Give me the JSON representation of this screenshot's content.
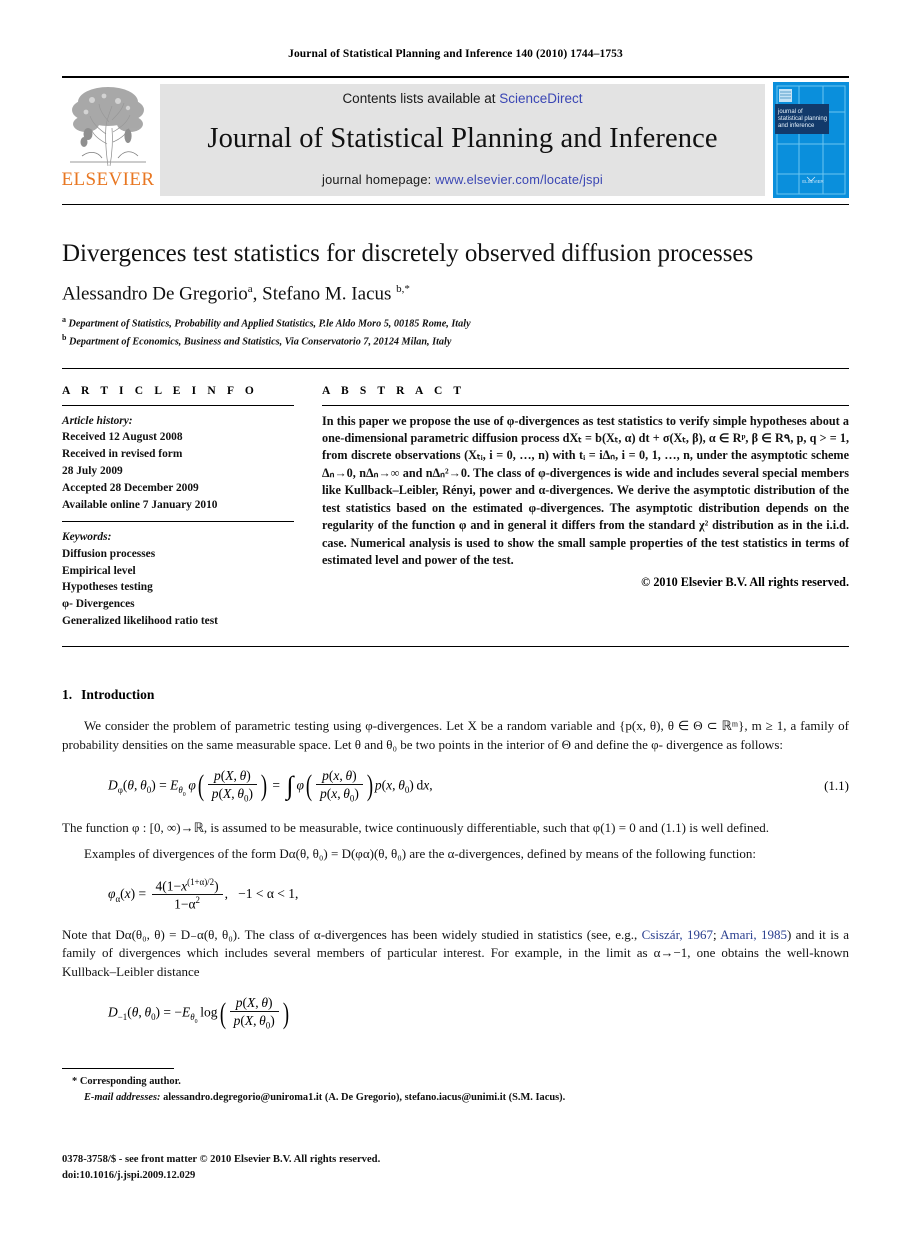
{
  "running_head": "Journal of Statistical Planning and Inference 140 (2010) 1744–1753",
  "masthead": {
    "publisher_wordmark": "ELSEVIER",
    "contents_prefix": "Contents lists available at ",
    "contents_link": "ScienceDirect",
    "journal_title": "Journal of Statistical Planning and Inference",
    "homepage_prefix": "journal homepage: ",
    "homepage_link": "www.elsevier.com/locate/jspi",
    "cover_title_lines": [
      "journal of",
      "statistical planning",
      "and inference"
    ],
    "cover_footer": "ELSEVIER",
    "colors": {
      "link": "#3a46b4",
      "elsevier_orange": "#E87722",
      "band_gray": "#e3e3e3",
      "cover_blue": "#0a8fdc",
      "cover_navy": "#123a6b"
    }
  },
  "article": {
    "title": "Divergences test statistics for discretely observed diffusion processes",
    "authors": "Alessandro De Gregorio ᵃ, Stefano M. Iacus ᵇ,*",
    "author_list": [
      {
        "name": "Alessandro De Gregorio",
        "marker": "a"
      },
      {
        "name": "Stefano M. Iacus",
        "marker": "b,*"
      }
    ],
    "affiliations": [
      {
        "marker": "a",
        "text": "Department of Statistics, Probability and Applied Statistics, P.le Aldo Moro 5, 00185 Rome, Italy"
      },
      {
        "marker": "b",
        "text": "Department of Economics, Business and Statistics, Via Conservatorio 7, 20124 Milan, Italy"
      }
    ]
  },
  "info": {
    "heading": "A R T I C L E   I N F O",
    "history_label": "Article history:",
    "history_lines": [
      "Received 12 August 2008",
      "Received in revised form",
      "28 July 2009",
      "Accepted 28 December 2009",
      "Available online 7 January 2010"
    ],
    "keywords_label": "Keywords:",
    "keywords": [
      "Diffusion processes",
      "Empirical level",
      "Hypotheses testing",
      "φ- Divergences",
      "Generalized likelihood ratio test"
    ]
  },
  "abstract": {
    "heading": "A B S T R A C T",
    "text": "In this paper we propose the use of φ-divergences as test statistics to verify simple hypotheses about a one-dimensional parametric diffusion process dXₜ = b(Xₜ, α) dt + σ(Xₜ, β), α ∈ Rᵖ, β ∈ R۹, p, q > = 1, from discrete observations (Xₜᵢ, i = 0, …, n) with tᵢ = iΔₙ, i = 0, 1, …, n, under the asymptotic scheme Δₙ→0, nΔₙ→∞ and nΔₙ²→0. The class of φ-divergences is wide and includes several special members like Kullback–Leibler, Rényi, power and α-divergences. We derive the asymptotic distribution of the test statistics based on the estimated φ-divergences. The asymptotic distribution depends on the regularity of the function φ and in general it differs from the standard χ² distribution as in the i.i.d. case. Numerical analysis is used to show the small sample properties of the test statistics in terms of estimated level and power of the test.",
    "copyright": "© 2010 Elsevier B.V. All rights reserved."
  },
  "section": {
    "number": "1.",
    "heading": "Introduction",
    "para1": "We consider the problem of parametric testing using φ-divergences. Let X be a random variable and {p(x, θ), θ ∈ Θ ⊂ ℝᵐ}, m ≥ 1, a family of probability densities on the same measurable space. Let θ and θ₀ be two points in the interior of Θ and define the φ- divergence as follows:",
    "eq1_number": "(1.1)",
    "para2": "The function φ : [0, ∞)→ℝ, is assumed to be measurable, twice continuously differentiable, such that φ(1) = 0 and (1.1) is well defined.",
    "para3": "Examples of divergences of the form Dα(θ, θ₀) = D(φα)(θ, θ₀) are the α-divergences, defined by means of the following function:",
    "para4_pre": "Note that Dα(θ₀, θ) = D₋α(θ, θ₀). The class of α-divergences has been widely studied in statistics (see, e.g., ",
    "cite1": "Csiszár, 1967",
    "para4_mid": "; ",
    "cite2": "Amari, 1985",
    "para4_post": ") and it is a family of divergences which includes several members of particular interest. For example, in the limit as α→−1, one obtains the well-known Kullback–Leibler distance"
  },
  "footnotes": {
    "corresponding_marker": "*",
    "corresponding_text": "Corresponding author.",
    "email_label": "E-mail addresses:",
    "email_text": "alessandro.degregorio@uniroma1.it (A. De Gregorio), stefano.iacus@unimi.it (S.M. Iacus)."
  },
  "imprint": {
    "line1": "0378-3758/$ - see front matter © 2010 Elsevier B.V. All rights reserved.",
    "line2": "doi:10.1016/j.jspi.2009.12.029"
  }
}
